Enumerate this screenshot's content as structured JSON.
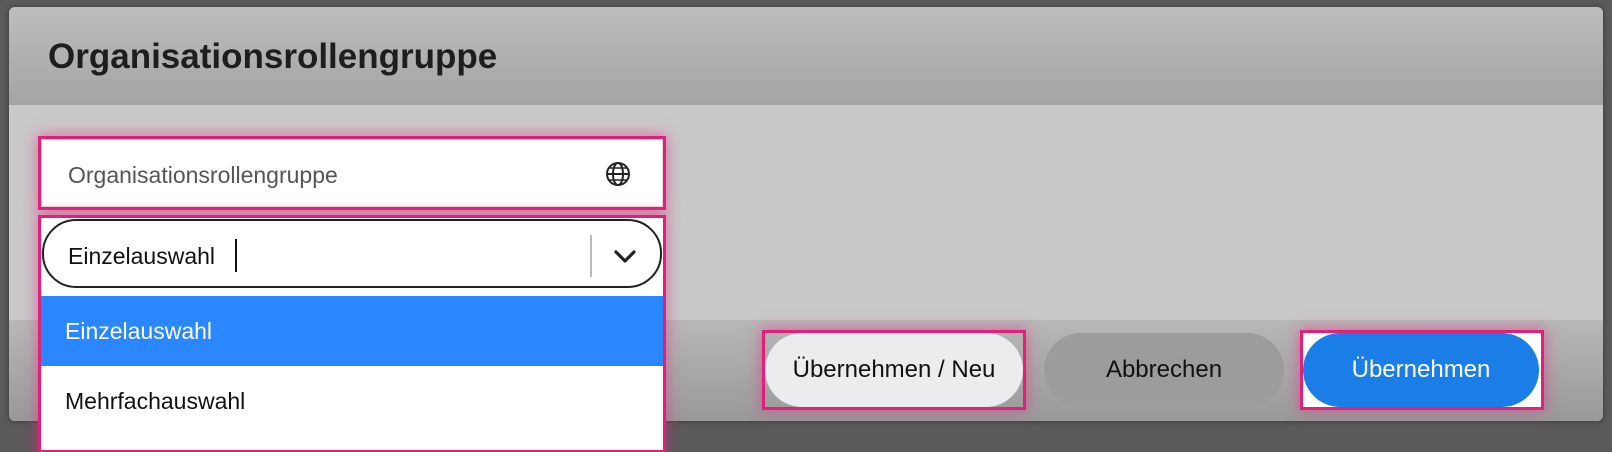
{
  "dialog": {
    "title": "Organisationsrollengruppe"
  },
  "name_field": {
    "value": "Organisationsrollengruppe",
    "icon": "globe-icon"
  },
  "selection_type": {
    "value": "Einzelauswahl",
    "options": [
      "Einzelauswahl",
      "Mehrfachauswahl"
    ],
    "selected_index": 0
  },
  "buttons": {
    "apply_new": "Übernehmen / Neu",
    "cancel": "Abbrechen",
    "apply": "Übernehmen"
  },
  "colors": {
    "highlight": "#e0217a",
    "selected_option": "#2b87ff",
    "primary_button": "#1a7ee6"
  }
}
